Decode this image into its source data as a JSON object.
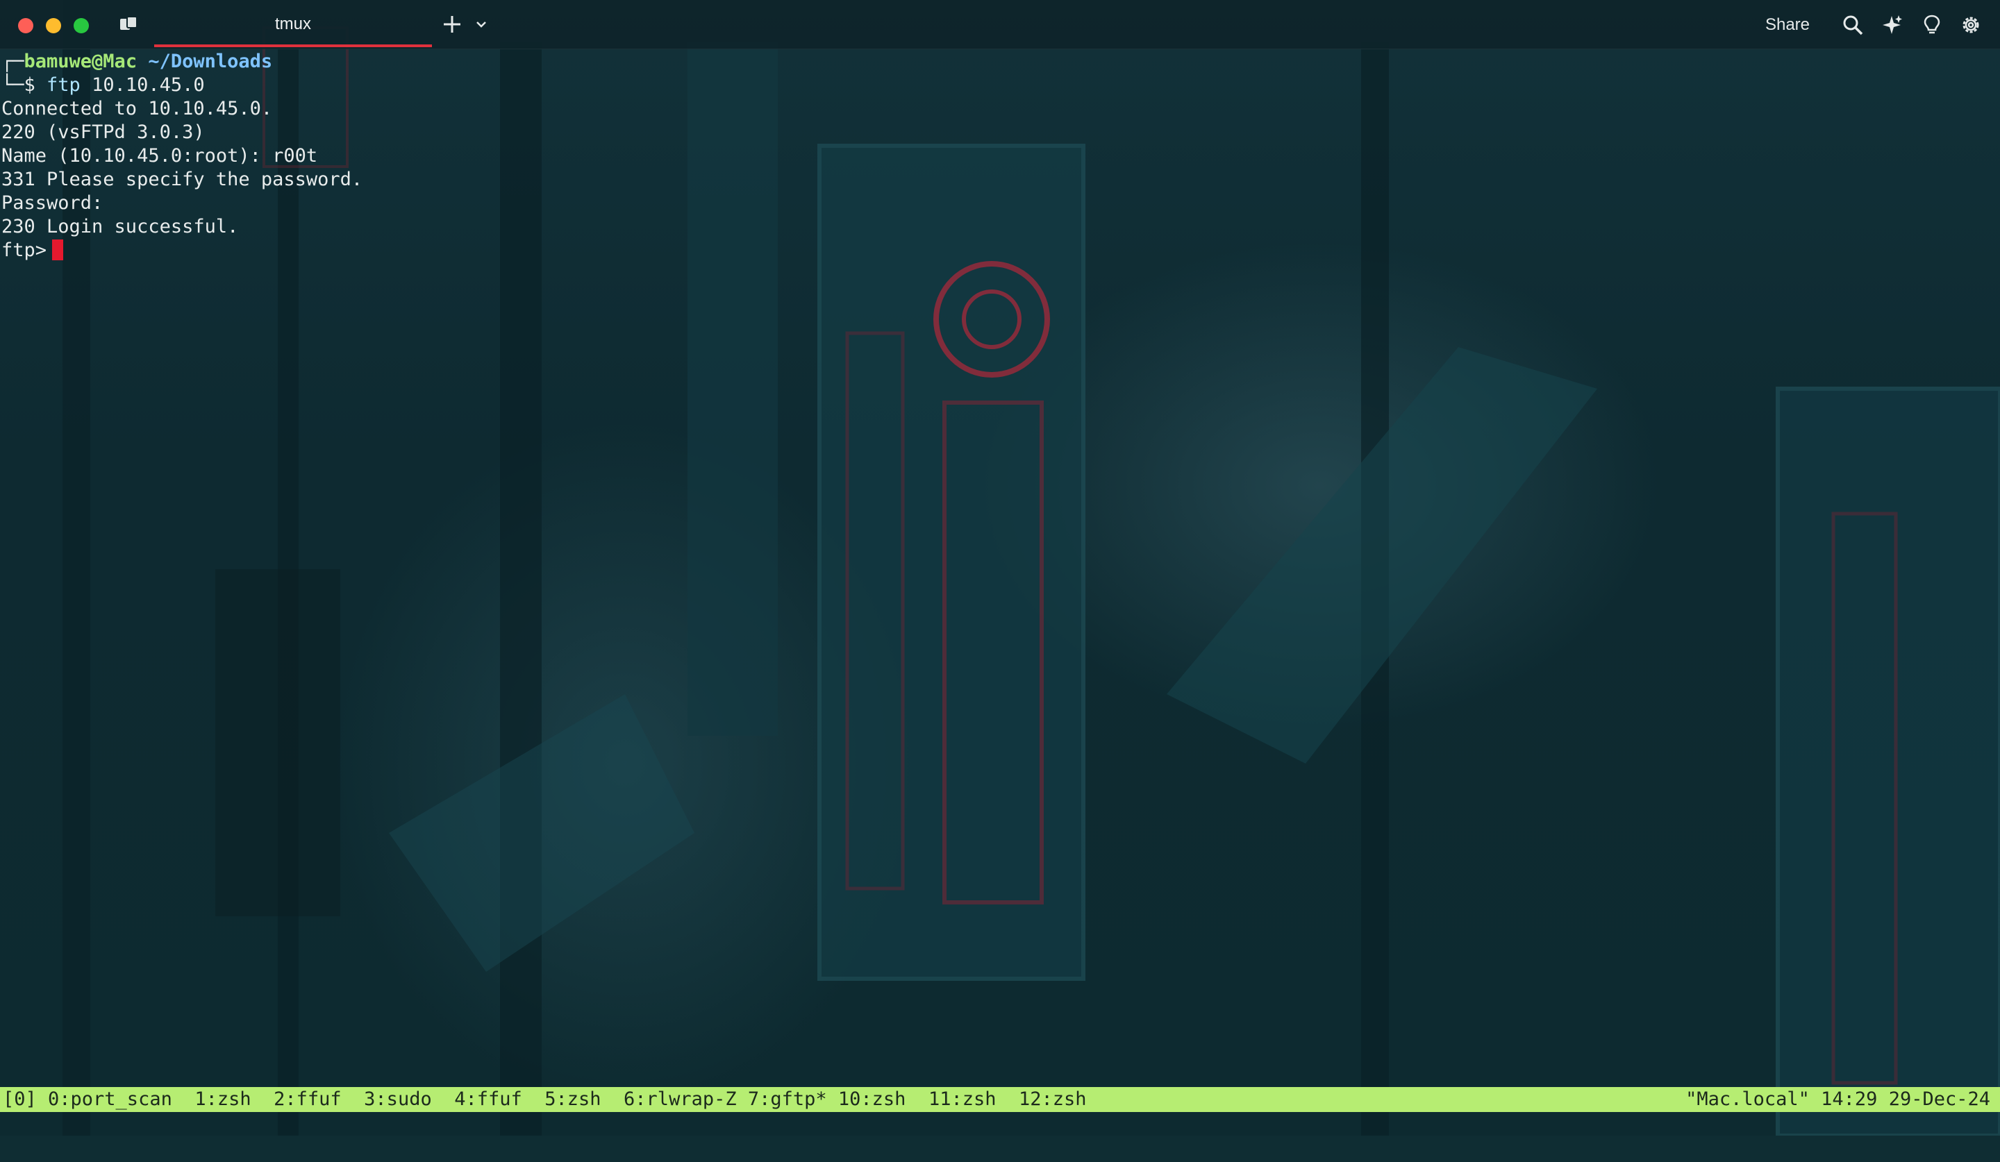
{
  "window": {
    "tab_title": "tmux",
    "share_label": "Share",
    "icons": [
      "sidebar-icon",
      "plus-icon",
      "chevron-down-icon",
      "search-icon",
      "ai-sparkle-icon",
      "lightbulb-icon",
      "gear-icon"
    ]
  },
  "colors": {
    "tab_accent": "#e0313c",
    "status_bar": "#b6ed72",
    "prompt_user": "#a6e878",
    "prompt_dir": "#7fc3ff",
    "cursor": "#e5192e"
  },
  "terminal": {
    "prompt_frame_top": "┌─",
    "prompt_user": "bamuwe@Mac",
    "prompt_dir": "~/Downloads",
    "prompt_frame_bottom": "└─",
    "prompt_symbol": "$ ",
    "command": "ftp",
    "command_args": " 10.10.45.0",
    "output": [
      "Connected to 10.10.45.0.",
      "220 (vsFTPd 3.0.3)",
      "Name (10.10.45.0:root): r00t",
      "331 Please specify the password.",
      "Password:",
      "230 Login successful."
    ],
    "ftp_prompt": "ftp>"
  },
  "status_bar": {
    "windows": "[0] 0:port_scan  1:zsh  2:ffuf  3:sudo  4:ffuf  5:zsh  6:rlwrap-Z 7:gftp* 10:zsh  11:zsh  12:zsh",
    "right": "\"Mac.local\" 14:29 29-Dec-24"
  }
}
